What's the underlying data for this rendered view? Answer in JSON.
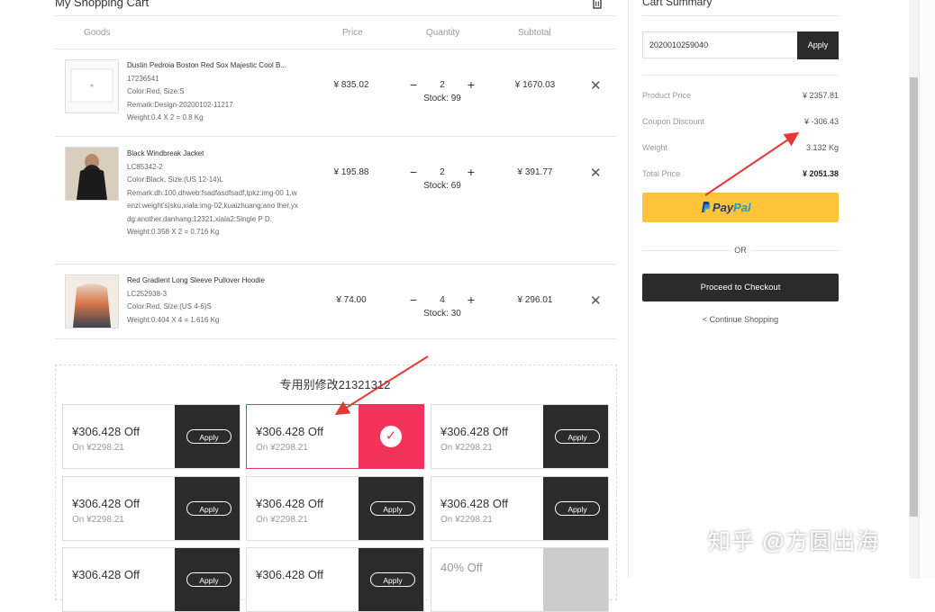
{
  "cart": {
    "title": "My Shopping Cart",
    "columns": [
      "Goods",
      "Price",
      "Quantity",
      "Subtotal"
    ],
    "items": [
      {
        "name": "Dustin Pedroia Boston Red Sox Majestic Cool B...",
        "sku": "17236541",
        "color_size": "Color:Red, Size:S",
        "remark": "Remark:Design-20200102-11217",
        "weight": "Weight:0.4 X 2 = 0.8 Kg",
        "price": "¥ 835.02",
        "qty": "2",
        "stock": "Stock: 99",
        "subtotal": "¥ 1670.03"
      },
      {
        "name": "Black Windbreak Jacket",
        "sku": "LC85342-2",
        "color_size": "Color:Black, Size:(US 12-14)L",
        "remark": "Remark:dh:100,dhweb:fsadfasdfsadf,tpkz:img-00 1,wenzi:weight's|sku,xiala:img-02,kuaizhuang:ano ther,yxdg:another,danhang:12321,xiala2:Single P D.",
        "weight": "Weight:0.358 X 2 = 0.716 Kg",
        "price": "¥ 195.88",
        "qty": "2",
        "stock": "Stock: 69",
        "subtotal": "¥ 391.77"
      },
      {
        "name": "Red Gradient Long Sleeve Pullover Hoodie",
        "sku": "LC252938-3",
        "color_size": "Color:Red, Size:(US 4-6)S",
        "remark": "",
        "weight": "Weight:0.404 X 4 = 1.616 Kg",
        "price": "¥ 74.00",
        "qty": "4",
        "stock": "Stock: 30",
        "subtotal": "¥ 296.01"
      }
    ],
    "minus": "−",
    "plus": "+",
    "remove": "✕"
  },
  "coupons": {
    "heading": "专用别修改21321312",
    "apply_label": "Apply",
    "check_icon": "✓",
    "items": [
      {
        "amount": "¥306.428 Off",
        "condition": "On ¥2298.21",
        "state": "apply"
      },
      {
        "amount": "¥306.428 Off",
        "condition": "On ¥2298.21",
        "state": "selected"
      },
      {
        "amount": "¥306.428 Off",
        "condition": "On ¥2298.21",
        "state": "apply"
      },
      {
        "amount": "¥306.428 Off",
        "condition": "On ¥2298.21",
        "state": "apply"
      },
      {
        "amount": "¥306.428 Off",
        "condition": "On ¥2298.21",
        "state": "apply"
      },
      {
        "amount": "¥306.428 Off",
        "condition": "On ¥2298.21",
        "state": "apply"
      },
      {
        "amount": "¥306.428 Off",
        "condition": "",
        "state": "apply"
      },
      {
        "amount": "¥306.428 Off",
        "condition": "",
        "state": "apply"
      },
      {
        "amount": "40% Off",
        "condition": "",
        "state": "disabled"
      }
    ]
  },
  "summary": {
    "title": "Cart Summary",
    "coupon_code": "2020010259040",
    "apply_label": "Apply",
    "product_price_label": "Product Price",
    "product_price": "¥ 2357.81",
    "coupon_discount_label": "Coupon Discount",
    "coupon_discount": "¥ -306.43",
    "weight_label": "Weight",
    "weight": "3.132 Kg",
    "total_label": "Total Price",
    "total": "¥ 2051.38",
    "paypal_part1": "Pay",
    "paypal_part2": "Pal",
    "or_label": "OR",
    "checkout_label": "Proceed to Checkout",
    "continue_label": "< Continue Shopping"
  },
  "watermark": "知乎 @方圆出海",
  "colors": {
    "accent": "#f2335b",
    "dark": "#2b2b2b",
    "paypal": "#ffc439",
    "annotation_arrow": "#e53935"
  },
  "icons": [
    "trash-icon",
    "minus-icon",
    "plus-icon",
    "close-icon",
    "check-icon",
    "paypal-logo-icon"
  ]
}
